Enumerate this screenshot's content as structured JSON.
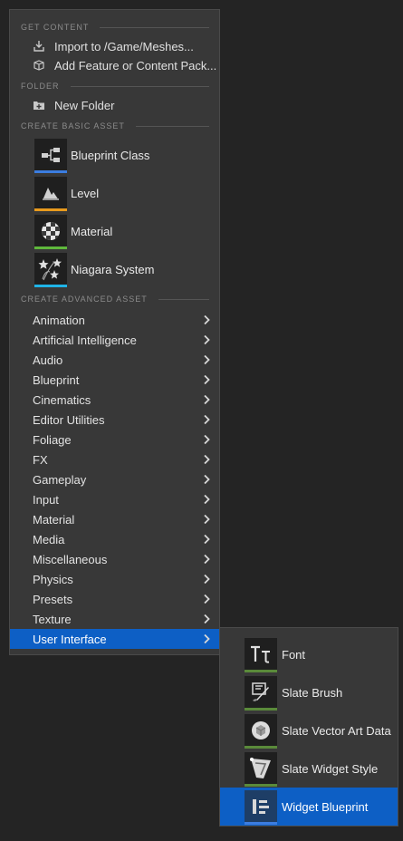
{
  "menu": {
    "get_content": {
      "header": "GET CONTENT",
      "items": [
        {
          "label": "Import to /Game/Meshes...",
          "icon": "import-icon"
        },
        {
          "label": "Add Feature or Content Pack...",
          "icon": "content-pack-icon"
        }
      ]
    },
    "folder": {
      "header": "FOLDER",
      "items": [
        {
          "label": "New Folder",
          "icon": "new-folder-icon"
        }
      ]
    },
    "basic_assets": {
      "header": "CREATE BASIC ASSET",
      "items": [
        {
          "label": "Blueprint Class",
          "icon": "blueprint-class-icon",
          "color": "#3b7de0"
        },
        {
          "label": "Level",
          "icon": "level-icon",
          "color": "#e89a1d"
        },
        {
          "label": "Material",
          "icon": "material-icon",
          "color": "#5fb83c"
        },
        {
          "label": "Niagara System",
          "icon": "niagara-system-icon",
          "color": "#1fb3e6"
        }
      ]
    },
    "advanced_assets": {
      "header": "CREATE ADVANCED ASSET",
      "items": [
        {
          "label": "Animation"
        },
        {
          "label": "Artificial Intelligence"
        },
        {
          "label": "Audio"
        },
        {
          "label": "Blueprint"
        },
        {
          "label": "Cinematics"
        },
        {
          "label": "Editor Utilities"
        },
        {
          "label": "Foliage"
        },
        {
          "label": "FX"
        },
        {
          "label": "Gameplay"
        },
        {
          "label": "Input"
        },
        {
          "label": "Material"
        },
        {
          "label": "Media"
        },
        {
          "label": "Miscellaneous"
        },
        {
          "label": "Physics"
        },
        {
          "label": "Presets"
        },
        {
          "label": "Texture"
        },
        {
          "label": "User Interface",
          "selected": true
        }
      ]
    }
  },
  "submenu": {
    "items": [
      {
        "label": "Font",
        "icon": "font-icon",
        "color": "#5a8a3a"
      },
      {
        "label": "Slate Brush",
        "icon": "slate-brush-icon",
        "color": "#5a8a3a"
      },
      {
        "label": "Slate Vector Art Data",
        "icon": "slate-vector-art-icon",
        "color": "#5a8a3a"
      },
      {
        "label": "Slate Widget Style",
        "icon": "slate-widget-style-icon",
        "color": "#5a8a3a"
      },
      {
        "label": "Widget Blueprint",
        "icon": "widget-blueprint-icon",
        "color": "#3b7de0",
        "selected": true
      }
    ]
  },
  "colors": {
    "selection": "#0d5fc5",
    "menu_bg": "#383838",
    "background": "#242424"
  }
}
